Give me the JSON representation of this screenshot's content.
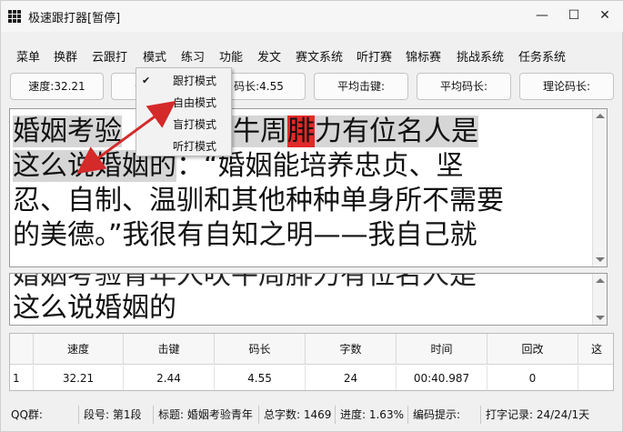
{
  "window": {
    "title": "极速跟打器[暂停]",
    "minimize": "—",
    "maximize": "☐",
    "close": "✕"
  },
  "menu": [
    "菜单",
    "换群",
    "云跟打",
    "模式",
    "练习",
    "功能",
    "发文",
    "赛文系统",
    "听打赛",
    "锦标赛",
    "挑战系统",
    "任务系统"
  ],
  "stats": {
    "speed": "速度:32.21",
    "keystroke": "击",
    "code_length": "码长:4.55",
    "avg_keystroke": "平均击键:",
    "avg_code_length": "平均码长:",
    "theory_code_length": "理论码长:"
  },
  "mode_menu": {
    "items": [
      "跟打模式",
      "自由模式",
      "盲打模式",
      "听打模式"
    ],
    "checked": "✔"
  },
  "source_text": {
    "line1_typed_a": "婚姻考验",
    "line1_typed_b": "年人吹牛周",
    "line1_error": "腓",
    "line1_typed_c": "力有位名人是",
    "line2_typed": "这么说婚姻的",
    "line2_rest": "：“婚姻能培养忠贞、坚",
    "line3": "忍、自制、温驯和其他种种单身所不需要",
    "line4": "的美德。”我很有自知之明——我自己就"
  },
  "input_text": {
    "line1": "婚姻考验青年人吹牛周腓力有位名人是",
    "line2": "这么说婚姻的"
  },
  "table": {
    "headers": [
      "",
      "速度",
      "击键",
      "码长",
      "字数",
      "时间",
      "回改",
      "这"
    ],
    "rows": [
      [
        "1",
        "32.21",
        "2.44",
        "4.55",
        "24",
        "00:40.987",
        "0",
        ""
      ]
    ]
  },
  "statusbar": {
    "qq_group": "QQ群:",
    "segment": "段号: 第1段",
    "article_title": "标题: 婚姻考验青年",
    "total_chars": "总字数: 1469",
    "progress": "进度: 1.63%",
    "code_hint": "编码提示:",
    "record": "打字记录: 24/24/1天"
  },
  "colors": {
    "error_highlight": "#e22929",
    "arrow": "#d42a2a",
    "typed_highlight": "#d6d6d6"
  }
}
